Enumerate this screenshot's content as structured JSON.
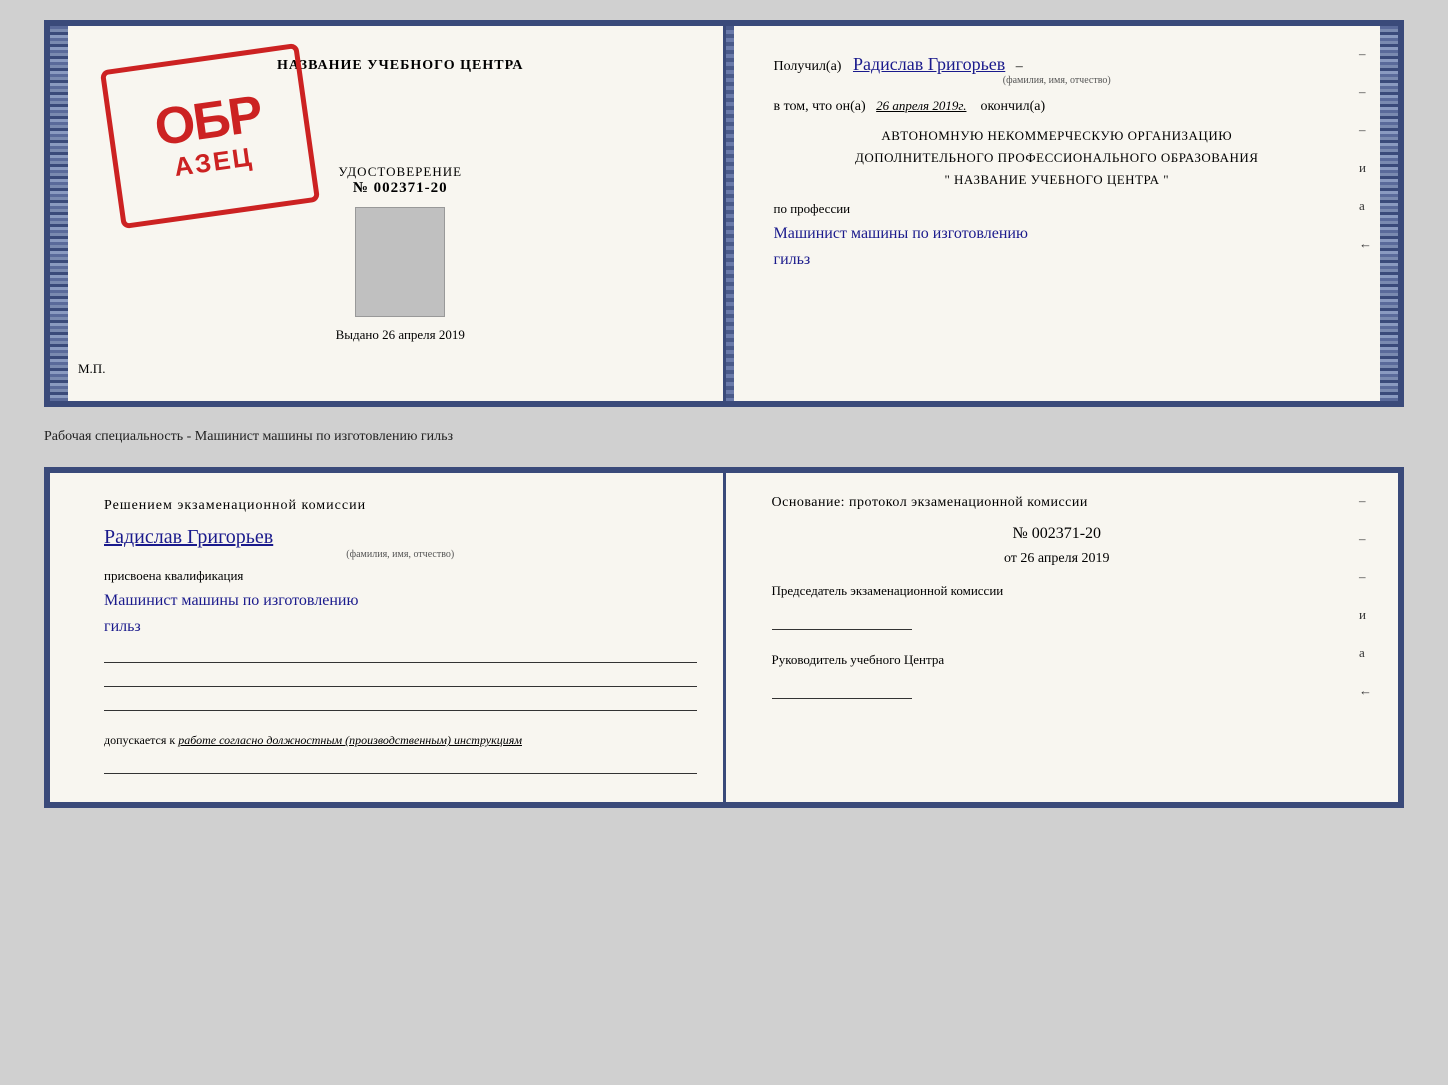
{
  "top_doc": {
    "left": {
      "title": "НАЗВАНИЕ УЧЕБНОГО ЦЕНТРА",
      "stamp": {
        "line1": "ОБР",
        "line2": "АЗЕЦ"
      },
      "udostoverenie": {
        "label": "УДОСТОВЕРЕНИЕ",
        "number": "№ 002371-20"
      },
      "vydano": "Выдано 26 апреля 2019",
      "mp": "М.П."
    },
    "right": {
      "poluchil_label": "Получил(а)",
      "name_handwritten": "Радислав Григорьев",
      "name_sublabel": "(фамилия, имя, отчество)",
      "vtom_label": "в том, что он(а)",
      "date_val": "26 апреля 2019г.",
      "okonchill_label": "окончил(а)",
      "avt_line1": "АВТОНОМНУЮ НЕКОММЕРЧЕСКУЮ ОРГАНИЗАЦИЮ",
      "avt_line2": "ДОПОЛНИТЕЛЬНОГО ПРОФЕССИОНАЛЬНОГО ОБРАЗОВАНИЯ",
      "avt_line3": "\"   НАЗВАНИЕ УЧЕБНОГО ЦЕНТРА   \"",
      "po_professii": "по профессии",
      "profession_line1": "Машинист машины по изготовлению",
      "profession_line2": "гильз",
      "dash1": "–",
      "dash2": "–",
      "dash3": "–",
      "i_label": "и",
      "a_label": "а",
      "arrow": "←"
    }
  },
  "caption": "Рабочая специальность - Машинист машины по изготовлению гильз",
  "bottom_doc": {
    "left": {
      "reshen_title": "Решением  экзаменационной  комиссии",
      "name_handwritten": "Радислав Григорьев",
      "name_sublabel": "(фамилия, имя, отчество)",
      "prisvoena": "присвоена квалификация",
      "kvalif_line1": "Машинист машины по изготовлению",
      "kvalif_line2": "гильз",
      "dopuskaetsya_prefix": "допускается к ",
      "dopuskaetsya_italic": "работе согласно должностным (производственным) инструкциям"
    },
    "right": {
      "osnov_title": "Основание: протокол экзаменационной  комиссии",
      "protocol_num": "№  002371-20",
      "ot_label": "от",
      "date": "26 апреля 2019",
      "predsedatel_label": "Председатель экзаменационной комиссии",
      "rukovoditel_label": "Руководитель учебного Центра",
      "dash1": "–",
      "dash2": "–",
      "dash3": "–",
      "i_label": "и",
      "a_label": "а",
      "arrow": "←"
    }
  }
}
